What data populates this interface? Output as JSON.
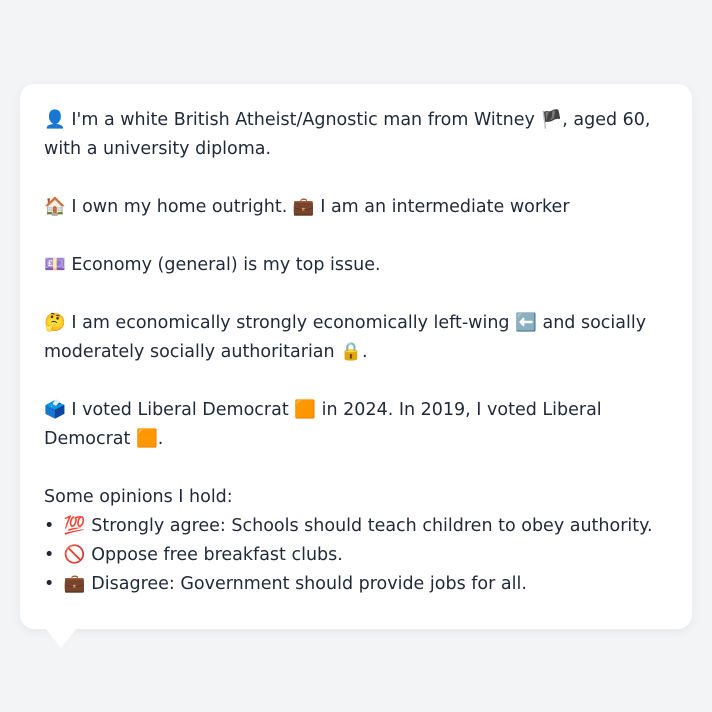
{
  "profile": {
    "identity": {
      "icon": "👤",
      "text_before": "I'm a white British Atheist/Agnostic man from Witney",
      "flag": "🏴",
      "text_after": ", aged 60, with a university diploma."
    },
    "housing": {
      "icon": "🏠",
      "text": "I own my home outright.",
      "work_icon": "💼",
      "work_text": "I am an intermediate worker"
    },
    "issue": {
      "icon": "💷",
      "text": "Economy (general) is my top issue."
    },
    "ideology": {
      "icon": "🤔",
      "text_before": "I am economically strongly economically left-wing",
      "left_icon": "⬅️",
      "text_middle": "and socially moderately socially authoritarian",
      "lock_icon": "🔒",
      "text_after": "."
    },
    "vote": {
      "icon": "🗳️",
      "text_before": "I voted Liberal Democrat",
      "party_icon_1": "🟧",
      "text_middle": "in 2024. In 2019, I voted Liberal Democrat",
      "party_icon_2": "🟧",
      "text_after": "."
    }
  },
  "opinions": {
    "heading": "Some opinions I hold:",
    "items": [
      {
        "bullet": "•",
        "icon": "💯",
        "text": "Strongly agree: Schools should teach children to obey authority."
      },
      {
        "bullet": "•",
        "icon": "🚫",
        "text": "Oppose free breakfast clubs."
      },
      {
        "bullet": "•",
        "icon": "💼",
        "text": "Disagree: Government should provide jobs for all."
      }
    ]
  }
}
